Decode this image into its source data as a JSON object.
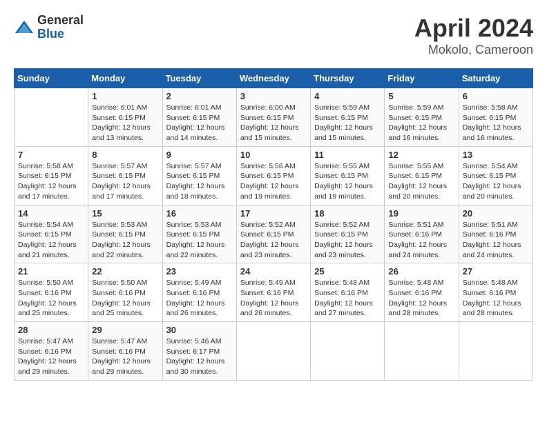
{
  "header": {
    "logo_general": "General",
    "logo_blue": "Blue",
    "title": "April 2024",
    "subtitle": "Mokolo, Cameroon"
  },
  "days_of_week": [
    "Sunday",
    "Monday",
    "Tuesday",
    "Wednesday",
    "Thursday",
    "Friday",
    "Saturday"
  ],
  "weeks": [
    [
      {
        "day": "",
        "info": ""
      },
      {
        "day": "1",
        "info": "Sunrise: 6:01 AM\nSunset: 6:15 PM\nDaylight: 12 hours\nand 13 minutes."
      },
      {
        "day": "2",
        "info": "Sunrise: 6:01 AM\nSunset: 6:15 PM\nDaylight: 12 hours\nand 14 minutes."
      },
      {
        "day": "3",
        "info": "Sunrise: 6:00 AM\nSunset: 6:15 PM\nDaylight: 12 hours\nand 15 minutes."
      },
      {
        "day": "4",
        "info": "Sunrise: 5:59 AM\nSunset: 6:15 PM\nDaylight: 12 hours\nand 15 minutes."
      },
      {
        "day": "5",
        "info": "Sunrise: 5:59 AM\nSunset: 6:15 PM\nDaylight: 12 hours\nand 16 minutes."
      },
      {
        "day": "6",
        "info": "Sunrise: 5:58 AM\nSunset: 6:15 PM\nDaylight: 12 hours\nand 16 minutes."
      }
    ],
    [
      {
        "day": "7",
        "info": "Sunrise: 5:58 AM\nSunset: 6:15 PM\nDaylight: 12 hours\nand 17 minutes."
      },
      {
        "day": "8",
        "info": "Sunrise: 5:57 AM\nSunset: 6:15 PM\nDaylight: 12 hours\nand 17 minutes."
      },
      {
        "day": "9",
        "info": "Sunrise: 5:57 AM\nSunset: 6:15 PM\nDaylight: 12 hours\nand 18 minutes."
      },
      {
        "day": "10",
        "info": "Sunrise: 5:56 AM\nSunset: 6:15 PM\nDaylight: 12 hours\nand 19 minutes."
      },
      {
        "day": "11",
        "info": "Sunrise: 5:55 AM\nSunset: 6:15 PM\nDaylight: 12 hours\nand 19 minutes."
      },
      {
        "day": "12",
        "info": "Sunrise: 5:55 AM\nSunset: 6:15 PM\nDaylight: 12 hours\nand 20 minutes."
      },
      {
        "day": "13",
        "info": "Sunrise: 5:54 AM\nSunset: 6:15 PM\nDaylight: 12 hours\nand 20 minutes."
      }
    ],
    [
      {
        "day": "14",
        "info": "Sunrise: 5:54 AM\nSunset: 6:15 PM\nDaylight: 12 hours\nand 21 minutes."
      },
      {
        "day": "15",
        "info": "Sunrise: 5:53 AM\nSunset: 6:15 PM\nDaylight: 12 hours\nand 22 minutes."
      },
      {
        "day": "16",
        "info": "Sunrise: 5:53 AM\nSunset: 6:15 PM\nDaylight: 12 hours\nand 22 minutes."
      },
      {
        "day": "17",
        "info": "Sunrise: 5:52 AM\nSunset: 6:15 PM\nDaylight: 12 hours\nand 23 minutes."
      },
      {
        "day": "18",
        "info": "Sunrise: 5:52 AM\nSunset: 6:15 PM\nDaylight: 12 hours\nand 23 minutes."
      },
      {
        "day": "19",
        "info": "Sunrise: 5:51 AM\nSunset: 6:16 PM\nDaylight: 12 hours\nand 24 minutes."
      },
      {
        "day": "20",
        "info": "Sunrise: 5:51 AM\nSunset: 6:16 PM\nDaylight: 12 hours\nand 24 minutes."
      }
    ],
    [
      {
        "day": "21",
        "info": "Sunrise: 5:50 AM\nSunset: 6:16 PM\nDaylight: 12 hours\nand 25 minutes."
      },
      {
        "day": "22",
        "info": "Sunrise: 5:50 AM\nSunset: 6:16 PM\nDaylight: 12 hours\nand 25 minutes."
      },
      {
        "day": "23",
        "info": "Sunrise: 5:49 AM\nSunset: 6:16 PM\nDaylight: 12 hours\nand 26 minutes."
      },
      {
        "day": "24",
        "info": "Sunrise: 5:49 AM\nSunset: 6:16 PM\nDaylight: 12 hours\nand 26 minutes."
      },
      {
        "day": "25",
        "info": "Sunrise: 5:48 AM\nSunset: 6:16 PM\nDaylight: 12 hours\nand 27 minutes."
      },
      {
        "day": "26",
        "info": "Sunrise: 5:48 AM\nSunset: 6:16 PM\nDaylight: 12 hours\nand 28 minutes."
      },
      {
        "day": "27",
        "info": "Sunrise: 5:48 AM\nSunset: 6:16 PM\nDaylight: 12 hours\nand 28 minutes."
      }
    ],
    [
      {
        "day": "28",
        "info": "Sunrise: 5:47 AM\nSunset: 6:16 PM\nDaylight: 12 hours\nand 29 minutes."
      },
      {
        "day": "29",
        "info": "Sunrise: 5:47 AM\nSunset: 6:16 PM\nDaylight: 12 hours\nand 29 minutes."
      },
      {
        "day": "30",
        "info": "Sunrise: 5:46 AM\nSunset: 6:17 PM\nDaylight: 12 hours\nand 30 minutes."
      },
      {
        "day": "",
        "info": ""
      },
      {
        "day": "",
        "info": ""
      },
      {
        "day": "",
        "info": ""
      },
      {
        "day": "",
        "info": ""
      }
    ]
  ]
}
